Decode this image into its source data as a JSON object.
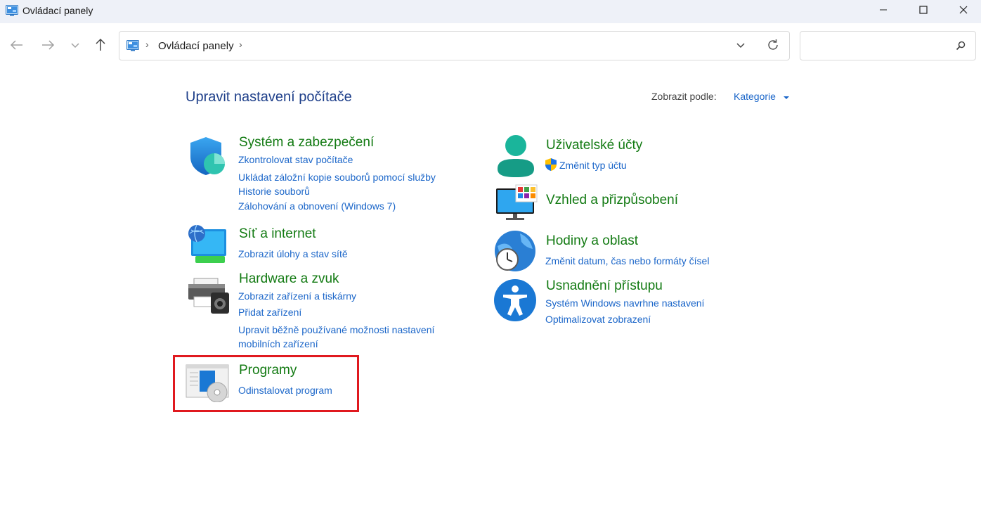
{
  "window": {
    "title": "Ovládací panely",
    "icon": "control-panel-icon",
    "controls": [
      "minimize-icon",
      "maximize-icon",
      "close-icon"
    ]
  },
  "navigation": {
    "breadcrumb": [
      "Ovládací panely"
    ],
    "search_placeholder": ""
  },
  "header": {
    "title": "Upravit nastavení počítače",
    "view_by_label": "Zobrazit podle:",
    "view_by_value": "Kategorie"
  },
  "left_column": [
    {
      "icon": "security-shield-icon",
      "title": "Systém a zabezpečení",
      "links": [
        "Zkontrolovat stav počítače",
        "Ukládat záložní kopie souborů pomocí služby Historie souborů",
        "Zálohování a obnovení (Windows 7)"
      ]
    },
    {
      "icon": "network-globe-icon",
      "title": "Síť a internet",
      "links": [
        "Zobrazit úlohy a stav sítě"
      ]
    },
    {
      "icon": "printer-speaker-icon",
      "title": "Hardware a zvuk",
      "links": [
        "Zobrazit zařízení a tiskárny",
        "Přidat zařízení",
        "Upravit běžně používané možnosti nastavení mobilních zařízení"
      ]
    },
    {
      "icon": "programs-disc-icon",
      "title": "Programy",
      "links": [
        "Odinstalovat program"
      ],
      "highlighted": true
    }
  ],
  "right_column": [
    {
      "icon": "user-accounts-icon",
      "title": "Uživatelské účty",
      "links": [
        "Změnit typ účtu"
      ],
      "link_icon": "uac-shield-icon"
    },
    {
      "icon": "appearance-monitor-icon",
      "title": "Vzhled a přizpůsobení",
      "links": []
    },
    {
      "icon": "clock-globe-icon",
      "title": "Hodiny a oblast",
      "links": [
        "Změnit datum, čas nebo formáty čísel"
      ]
    },
    {
      "icon": "accessibility-icon",
      "title": "Usnadnění přístupu",
      "links": [
        "Systém Windows navrhne nastavení",
        "Optimalizovat zobrazení"
      ]
    }
  ],
  "colors": {
    "heading": "#1e3f8a",
    "category_title": "#127a12",
    "link": "#1b66c9",
    "highlight_border": "#e0191f"
  }
}
